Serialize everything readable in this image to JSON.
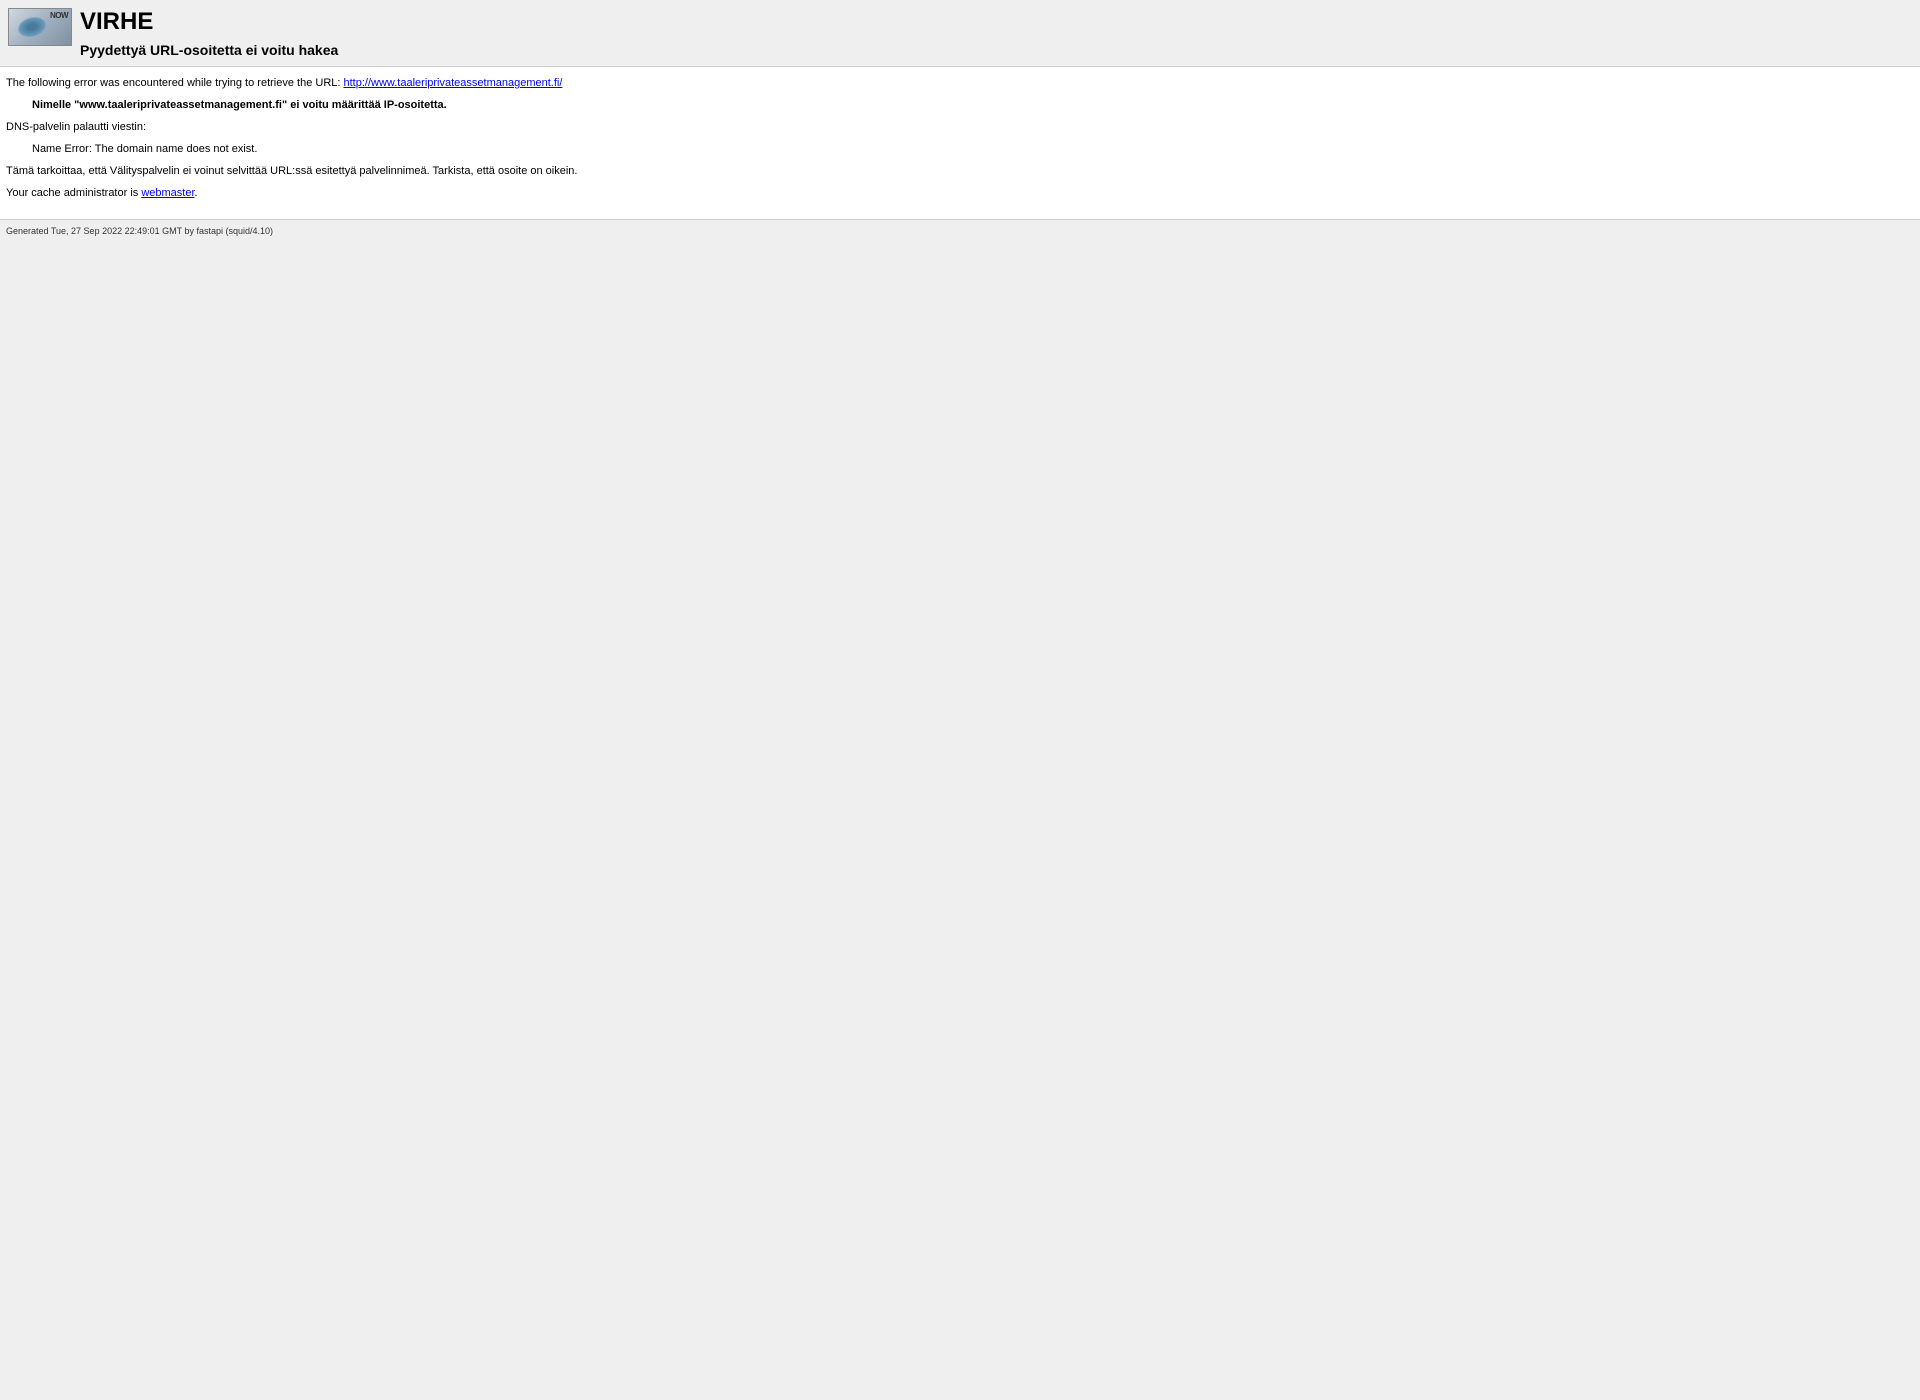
{
  "header": {
    "title": "VIRHE",
    "subtitle": "Pyydettyä URL-osoitetta ei voitu hakea",
    "logo_text": "NOW"
  },
  "content": {
    "error_prefix": "The following error was encountered while trying to retrieve the URL: ",
    "url_link": "http://www.taaleriprivateassetmanagement.fi/",
    "dns_error": "Nimelle \"www.taaleriprivateassetmanagement.fi\" ei voitu määrittää IP-osoitetta.",
    "dns_returned": "DNS-palvelin palautti viestin:",
    "name_error": "Name Error: The domain name does not exist.",
    "explanation": "Tämä tarkoittaa, että Välityspalvelin ei voinut selvittää URL:ssä esitettyä palvelinnimeä. Tarkista, että osoite on oikein.",
    "admin_prefix": "Your cache administrator is ",
    "admin_link": "webmaster",
    "admin_suffix": "."
  },
  "footer": {
    "generated": "Generated Tue, 27 Sep 2022 22:49:01 GMT by fastapi (squid/4.10)"
  }
}
